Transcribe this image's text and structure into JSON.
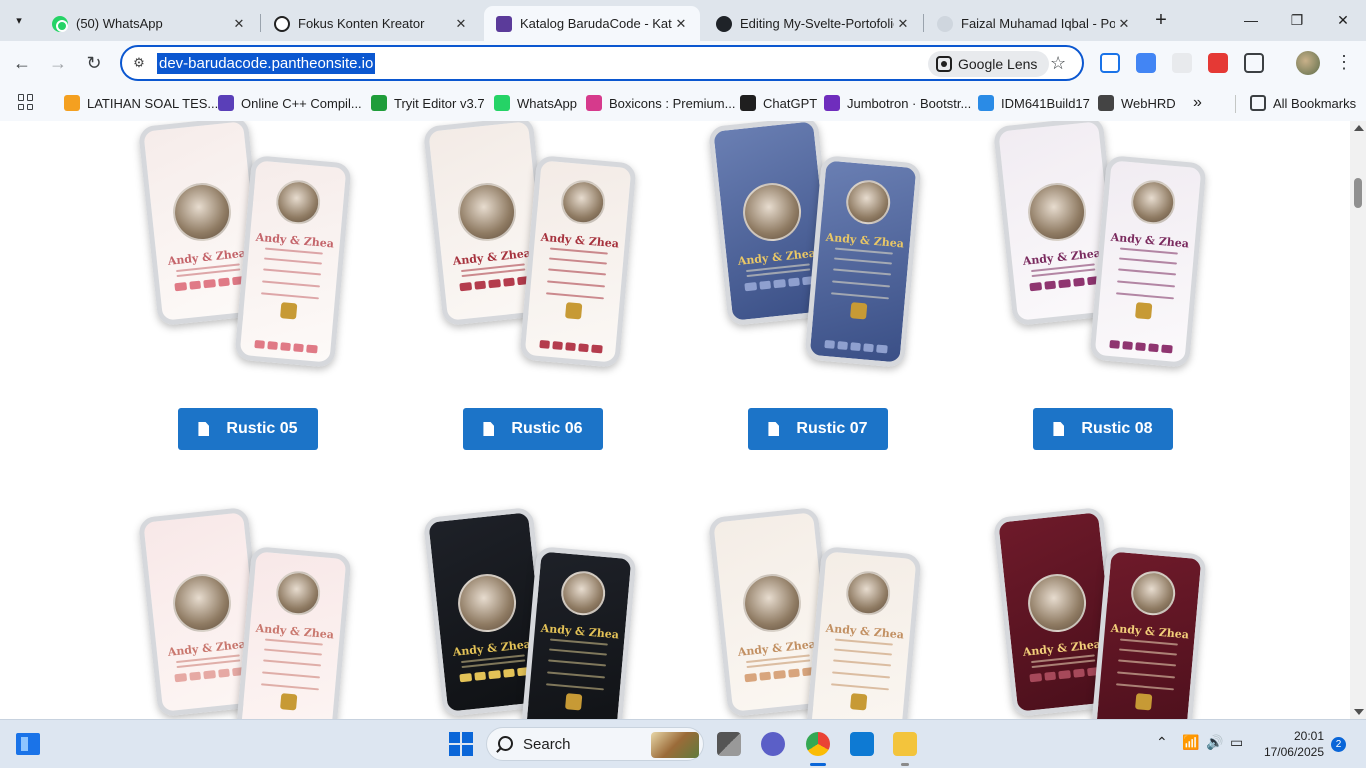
{
  "tabs": [
    {
      "title": "(50) WhatsApp",
      "icon": "whatsapp-icon",
      "active": false
    },
    {
      "title": "Fokus Konten Kreator",
      "icon": "openai-icon",
      "active": false
    },
    {
      "title": "Katalog BarudaCode - Katal",
      "icon": "barudacode-icon",
      "active": true
    },
    {
      "title": "Editing My-Svelte-Portofolio",
      "icon": "github-icon",
      "active": false
    },
    {
      "title": "Faizal Muhamad Iqbal - Port",
      "icon": "svelte-icon",
      "active": false
    }
  ],
  "omnibox": {
    "url": "dev-barudacode.pantheonsite.io",
    "lens_label": "Google Lens"
  },
  "bookmarks": [
    {
      "label": "LATIHAN SOAL TES...",
      "color": "#f4a020"
    },
    {
      "label": "Online C++ Compil...",
      "color": "#5a3fb8"
    },
    {
      "label": "Tryit Editor v3.7",
      "color": "#1f9d3a"
    },
    {
      "label": "WhatsApp",
      "color": "#25d366"
    },
    {
      "label": "Boxicons : Premium...",
      "color": "#d63a8c"
    },
    {
      "label": "ChatGPT",
      "color": "#1f1f1f"
    },
    {
      "label": "Jumbotron · Bootstr...",
      "color": "#6f2dbd"
    },
    {
      "label": "IDM641Build17",
      "color": "#2a8be6"
    },
    {
      "label": "WebHRD",
      "color": "#444444"
    }
  ],
  "all_bookmarks_label": "All Bookmarks",
  "catalog": [
    {
      "button": "Rustic 05"
    },
    {
      "button": "Rustic 06"
    },
    {
      "button": "Rustic 07"
    },
    {
      "button": "Rustic 08"
    }
  ],
  "catalog_button_color": "#1c74c8",
  "phone_caption": "Andy & Zhea",
  "taskbar": {
    "search_label": "Search",
    "time": "20:01",
    "date": "17/06/2025",
    "notifications": "2"
  }
}
